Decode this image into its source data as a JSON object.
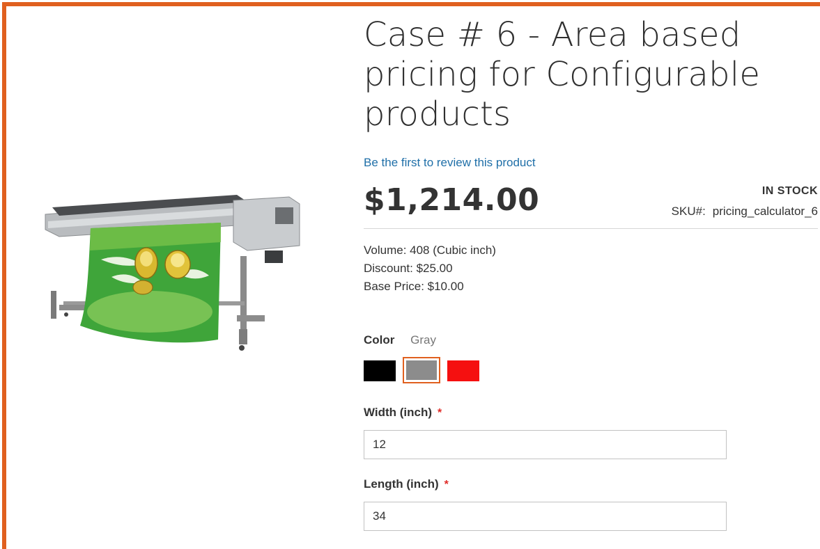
{
  "product": {
    "title": "Case # 6 - Area based pricing for Configurable products",
    "review_link": "Be the first to review this product",
    "price": "$1,214.00",
    "stock": "IN STOCK",
    "sku_label": "SKU#:",
    "sku_value": "pricing_calculator_6",
    "image_alt": "Large format printer"
  },
  "details": {
    "volume": "Volume: 408 (Cubic inch)",
    "discount": "Discount: $25.00",
    "base_price": "Base Price: $10.00"
  },
  "color": {
    "label": "Color",
    "selected": "Gray",
    "swatches": [
      {
        "name": "Black",
        "hex": "#000000"
      },
      {
        "name": "Gray",
        "hex": "#8c8c8c"
      },
      {
        "name": "Red",
        "hex": "#f51010"
      }
    ]
  },
  "fields": {
    "width_label": "Width (inch)",
    "width_value": "12",
    "length_label": "Length (inch)",
    "length_value": "34",
    "required_mark": "*"
  },
  "colors": {
    "accent": "#e0601f",
    "link": "#1f6fa8",
    "required": "#e02b27"
  }
}
